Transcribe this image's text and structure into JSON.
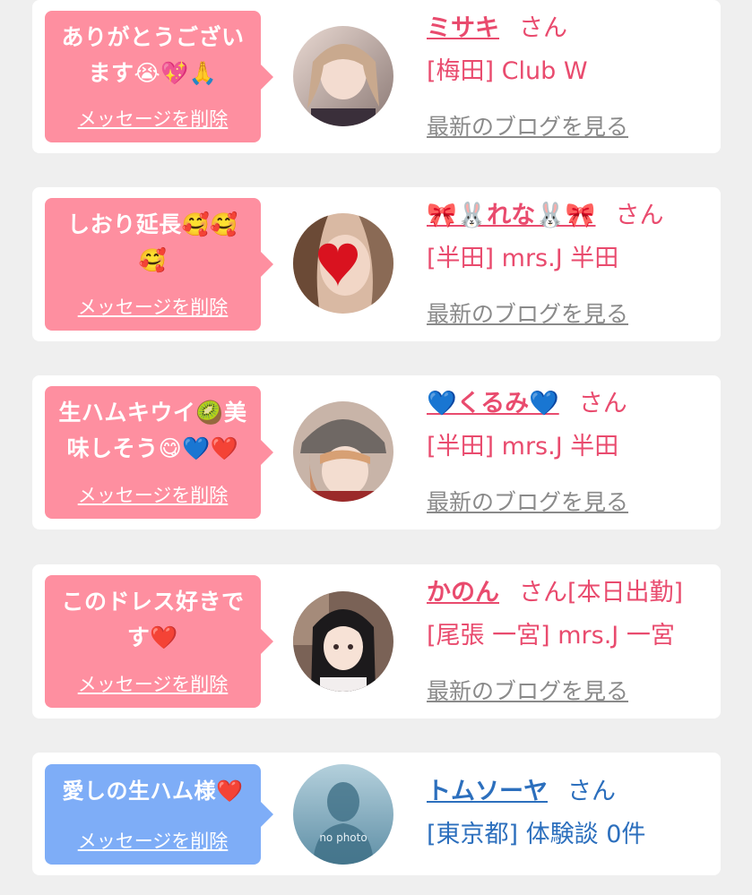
{
  "delete_label": "メッセージを削除",
  "blog_label": "最新のブログを見る",
  "san_label": "さん",
  "entries": [
    {
      "message": "ありがとうござい\nます😭💖🙏",
      "name": "ミサキ",
      "status": "",
      "shop": "[梅田] Club W",
      "has_blog": true
    },
    {
      "message": "しおり延長🥰🥰\n🥰",
      "name": "🎀🐰れな🐰🎀",
      "status": "",
      "shop": "[半田] mrs.J 半田",
      "has_blog": true
    },
    {
      "message": "生ハムキウイ🥝美\n味しそう😋💙❤️",
      "name": "💙くるみ💙",
      "status": "",
      "shop": "[半田] mrs.J 半田",
      "has_blog": true
    },
    {
      "message": "このドレス好きで\nす❤️",
      "name": "かのん",
      "status": "[本日出勤]",
      "shop": "[尾張 一宮] mrs.J 一宮",
      "has_blog": true
    },
    {
      "message": "愛しの生ハム様❤️",
      "name": "トムソーヤ",
      "status": "",
      "shop": "[東京都] 体験談 0件",
      "has_blog": false,
      "avatar_text": "no photo"
    }
  ]
}
